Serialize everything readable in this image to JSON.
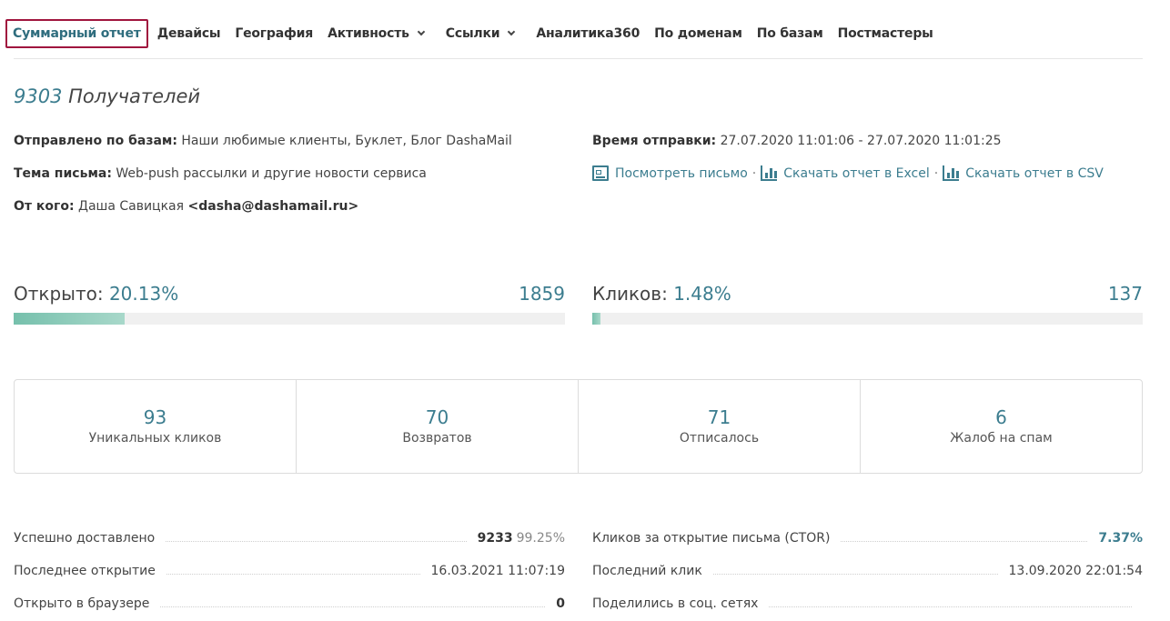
{
  "nav": {
    "items": [
      {
        "label": "Суммарный отчет"
      },
      {
        "label": "Девайсы"
      },
      {
        "label": "География"
      },
      {
        "label": "Активность"
      },
      {
        "label": "Ссылки"
      },
      {
        "label": "Аналитика360"
      },
      {
        "label": "По доменам"
      },
      {
        "label": "По базам"
      },
      {
        "label": "Постмастеры"
      }
    ]
  },
  "header": {
    "recipients_count": "9303",
    "recipients_label": "Получателей"
  },
  "details": {
    "sent_bases_label": "Отправлено по базам:",
    "sent_bases_value": "Наши любимые клиенты, Буклет, Блог DashaMail",
    "subject_label": "Тема письма:",
    "subject_value": "Web-push рассылки и другие новости сервиса",
    "from_label": "От кого:",
    "from_name": "Даша Савицкая",
    "from_email": "<dasha@dashamail.ru>",
    "send_time_label": "Время отправки:",
    "send_time_value": "27.07.2020 11:01:06 - 27.07.2020 11:01:25",
    "view_letter": "Посмотреть письмо",
    "download_excel": "Скачать отчет в Excel",
    "download_csv": "Скачать отчет в CSV",
    "separator": "·"
  },
  "opened": {
    "label": "Открыто:",
    "percent": "20.13%",
    "count": "1859",
    "fraction": 0.2013
  },
  "clicks": {
    "label": "Кликов:",
    "percent": "1.48%",
    "count": "137",
    "fraction": 0.0148
  },
  "stats": [
    {
      "value": "93",
      "label": "Уникальных кликов"
    },
    {
      "value": "70",
      "label": "Возвратов"
    },
    {
      "value": "71",
      "label": "Отписалось"
    },
    {
      "value": "6",
      "label": "Жалоб на спам"
    }
  ],
  "rows_left": [
    {
      "label": "Успешно доставлено",
      "value": "9233",
      "extra": "99.25%"
    },
    {
      "label": "Последнее открытие",
      "value": "16.03.2021 11:07:19"
    },
    {
      "label": "Открыто в браузере",
      "value": "0"
    }
  ],
  "rows_right": [
    {
      "label": "Кликов за открытие письма (CTOR)",
      "value": "7.37%"
    },
    {
      "label": "Последний клик",
      "value": "13.09.2020 22:01:54"
    },
    {
      "label": "Поделились в соц. сетях",
      "value": ""
    }
  ],
  "colors": {
    "accent": "#3c7d8f",
    "active_border": "#a0153e",
    "bar_fill": "#76c0ac"
  }
}
